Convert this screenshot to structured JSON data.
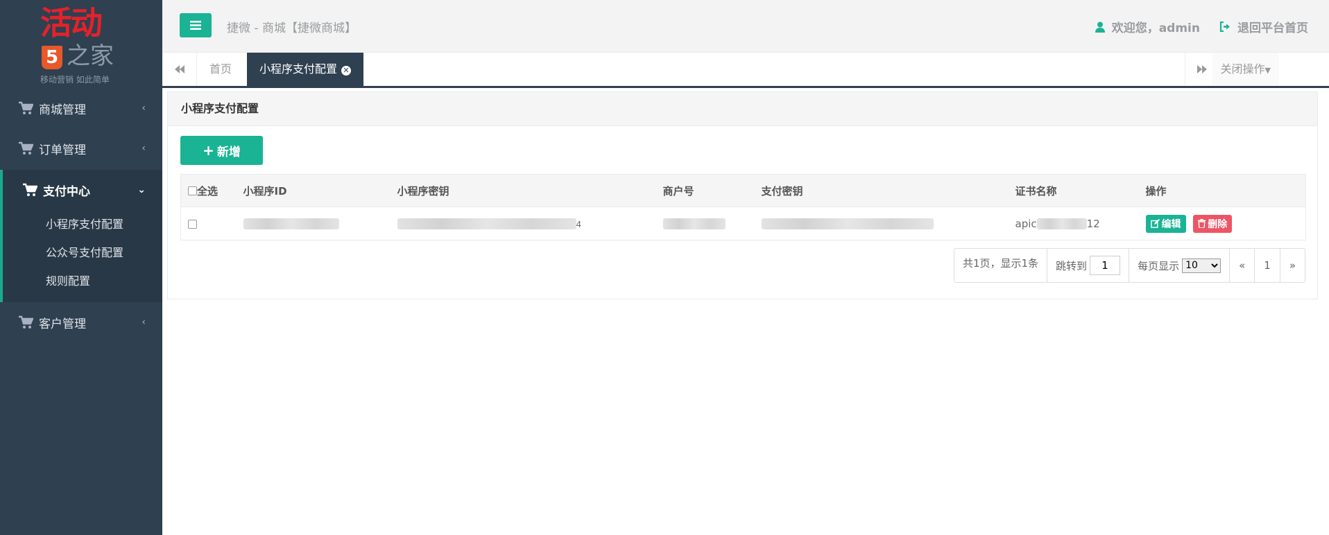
{
  "logo": {
    "title": "活动",
    "shield": "5",
    "home": "之家",
    "slogan": "移动营销 如此简单"
  },
  "sidebar": {
    "groups": [
      {
        "label": "商城管理"
      },
      {
        "label": "订单管理"
      },
      {
        "label": "支付中心",
        "items": [
          "小程序支付配置",
          "公众号支付配置",
          "规则配置"
        ]
      },
      {
        "label": "客户管理"
      }
    ]
  },
  "header": {
    "title": "捷微 - 商城【捷微商城】",
    "welcome": "欢迎您，admin",
    "back_home": "退回平台首页"
  },
  "tabs": {
    "home": "首页",
    "active": "小程序支付配置",
    "close_ops": "关闭操作"
  },
  "panel": {
    "title": "小程序支付配置",
    "add_label": "新增"
  },
  "table": {
    "select_all": "全选",
    "columns": [
      "小程序ID",
      "小程序密钥",
      "商户号",
      "支付密钥",
      "证书名称",
      "操作"
    ],
    "rows": [
      {
        "cert_prefix": "apic",
        "cert_suffix": "12",
        "secret_tail": "4",
        "edit": "编辑",
        "delete": "删除"
      }
    ]
  },
  "pager": {
    "summary": "共1页，显示1条",
    "jump_label": "跳转到",
    "jump_value": "1",
    "per_page_label": "每页显示",
    "per_page_value": "10",
    "prev": "«",
    "current": "1",
    "next": "»"
  },
  "colors": {
    "sidebar": "#2f4050",
    "accent": "#1ab394",
    "danger": "#ed5565"
  }
}
